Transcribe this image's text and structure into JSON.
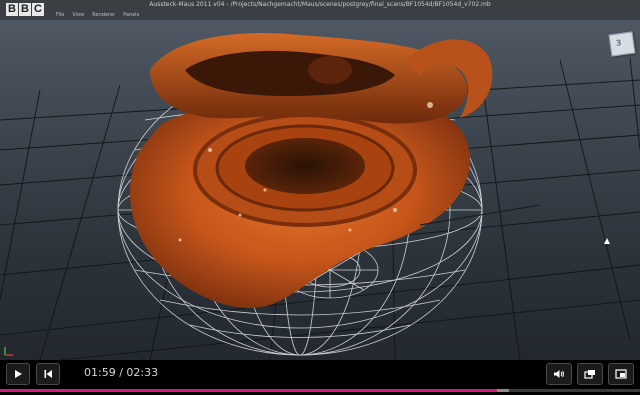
{
  "video": {
    "logo_letters": [
      "B",
      "B",
      "C"
    ],
    "window_title": "Aussteck-Maus 2011 v04 - /Projects/Nachgemacht/Maus/scenes/postgrey/final_scans/BF1054d/BF1054d_v702.mb",
    "menus": [
      "File",
      "View",
      "Renderer",
      "Panels"
    ],
    "viewcube_label": "3"
  },
  "player": {
    "current_time": "01:59",
    "separator": " / ",
    "total_time": "02:33",
    "progress_fraction": 0.777,
    "buffered_fraction": 0.795,
    "accent_color": "#d7197d"
  },
  "icons": {
    "play": "play-icon",
    "restart": "skip-back-icon",
    "volume": "volume-icon",
    "popout": "popout-icon",
    "fullscreen": "fullscreen-icon"
  }
}
